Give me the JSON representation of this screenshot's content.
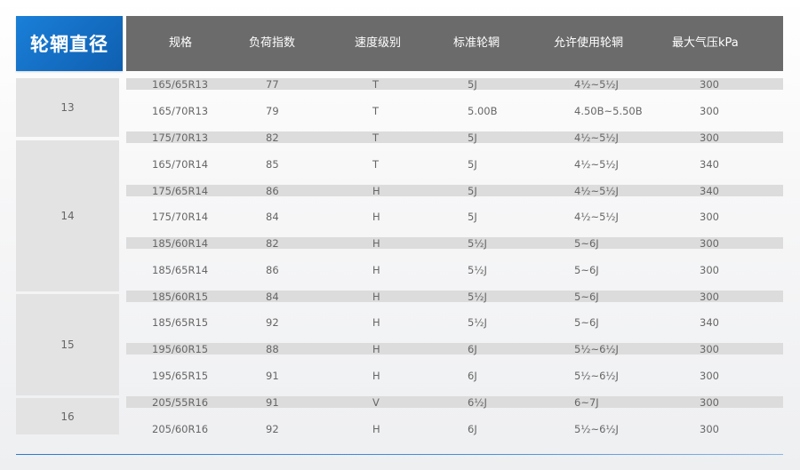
{
  "title": "轮辋直径",
  "headers": [
    "规格",
    "负荷指数",
    "速度级别",
    "标准轮辋",
    "允许使用轮辋",
    "最大气压kPa"
  ],
  "diameters": [
    "13",
    "14",
    "15",
    "16"
  ],
  "rows": [
    [
      "165/65R13",
      "77",
      "T",
      "5J",
      "4½~5½J",
      "300"
    ],
    [
      "165/70R13",
      "79",
      "T",
      "5.00B",
      "4.50B~5.50B",
      "300"
    ],
    [
      "175/70R13",
      "82",
      "T",
      "5J",
      "4½~5½J",
      "300"
    ],
    [
      "165/70R14",
      "85",
      "T",
      "5J",
      "4½~5½J",
      "340"
    ],
    [
      "175/65R14",
      "86",
      "H",
      "5J",
      "4½~5½J",
      "340"
    ],
    [
      "175/70R14",
      "84",
      "H",
      "5J",
      "4½~5½J",
      "300"
    ],
    [
      "185/60R14",
      "82",
      "H",
      "5½J",
      "5~6J",
      "300"
    ],
    [
      "185/65R14",
      "86",
      "H",
      "5½J",
      "5~6J",
      "300"
    ],
    [
      "185/60R15",
      "84",
      "H",
      "5½J",
      "5~6J",
      "300"
    ],
    [
      "185/65R15",
      "92",
      "H",
      "5½J",
      "5~6J",
      "340"
    ],
    [
      "195/60R15",
      "88",
      "H",
      "6J",
      "5½~6½J",
      "300"
    ],
    [
      "195/65R15",
      "91",
      "H",
      "6J",
      "5½~6½J",
      "300"
    ],
    [
      "205/55R16",
      "91",
      "V",
      "6½J",
      "6~7J",
      "300"
    ],
    [
      "205/60R16",
      "92",
      "H",
      "6J",
      "5½~6½J",
      "300"
    ]
  ],
  "colors": {
    "title_bg": "#1570c8",
    "header_bg": "#6b6b6b",
    "shaded_row": "#dcdcdc",
    "diameter_cell": "#e3e3e3",
    "footer_line": "#2d79d3"
  }
}
